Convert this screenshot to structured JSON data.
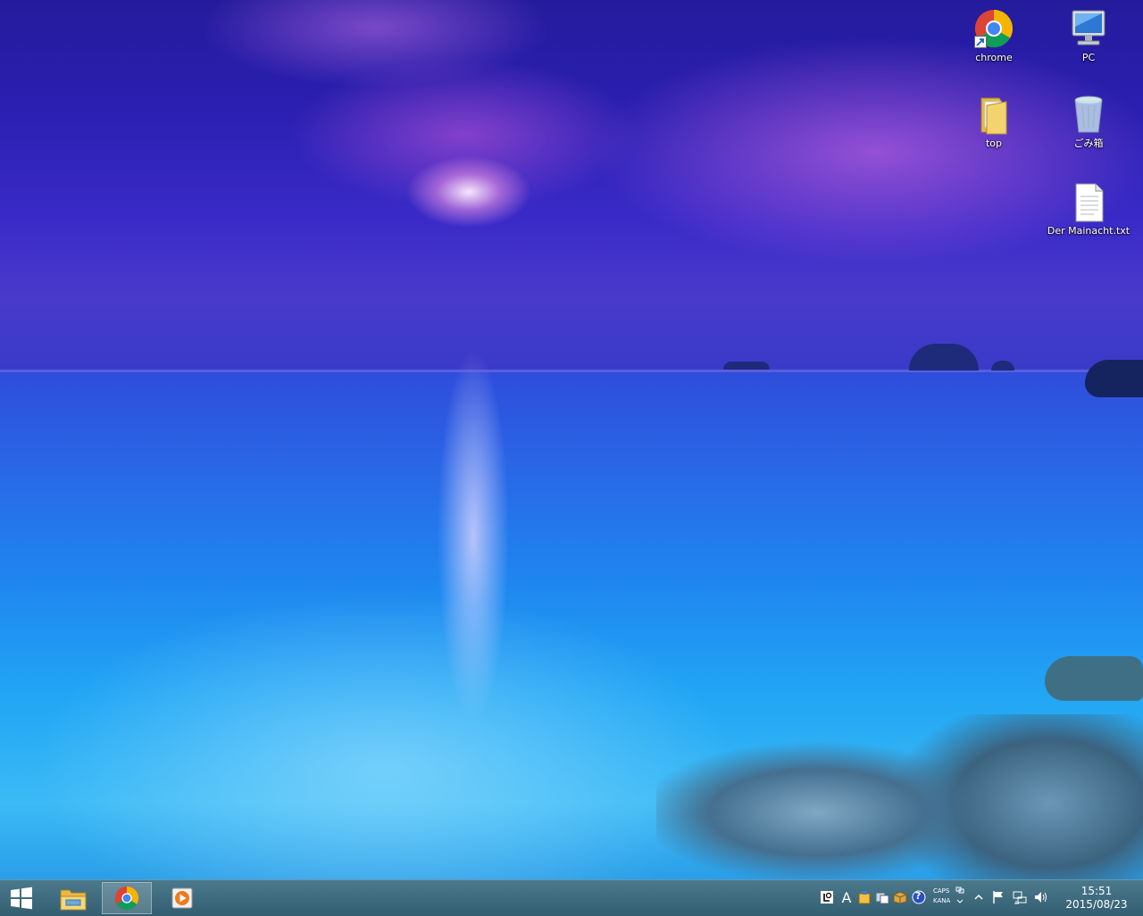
{
  "desktop": {
    "icons": [
      {
        "label": "chrome"
      },
      {
        "label": "PC"
      },
      {
        "label": "top"
      },
      {
        "label": "ごみ箱"
      },
      {
        "label": "Der Mainacht.txt"
      }
    ]
  },
  "taskbar": {
    "buttons": [
      {
        "name": "start-button",
        "icon": "windows-logo-icon"
      },
      {
        "name": "file-explorer-button",
        "icon": "folder-icon"
      },
      {
        "name": "chrome-taskbar-button",
        "icon": "chrome-icon",
        "active": true
      },
      {
        "name": "media-player-button",
        "icon": "play-icon"
      }
    ],
    "tray": {
      "ime_mode": "A",
      "caps": "CAPS",
      "kana": "KANA",
      "help_glyph": "?"
    },
    "clock": {
      "time": "15:51",
      "date": "2015/08/23"
    }
  },
  "colors": {
    "taskbar": "#2f6a80",
    "sky": "#2a1fb0",
    "sea": "#1f86ef"
  }
}
